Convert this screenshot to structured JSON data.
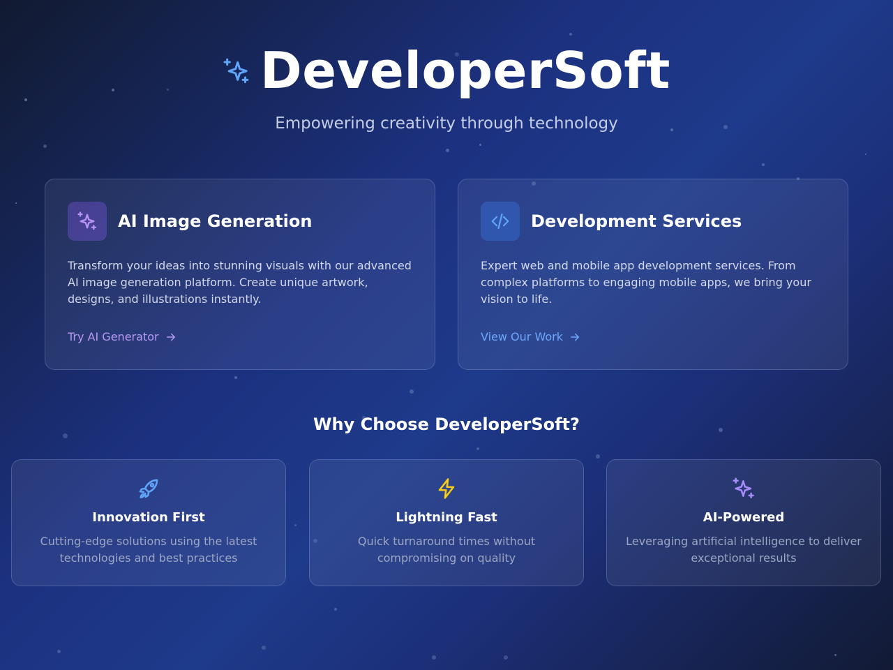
{
  "header": {
    "brand_icon": "sparkles-icon",
    "title": "DeveloperSoft",
    "tagline": "Empowering creativity through technology"
  },
  "services": [
    {
      "icon": "sparkles-icon",
      "title": "AI Image Generation",
      "description": "Transform your ideas into stunning visuals with our advanced AI image generation platform. Create unique artwork, designs, and illustrations instantly.",
      "link_label": "Try AI Generator",
      "accent": "#b89af4"
    },
    {
      "icon": "code-icon",
      "title": "Development Services",
      "description": "Expert web and mobile app development services. From complex platforms to engaging mobile apps, we bring your vision to life.",
      "link_label": "View Our Work",
      "accent": "#6ea8fb"
    }
  ],
  "why": {
    "title": "Why Choose DeveloperSoft?",
    "features": [
      {
        "icon": "rocket-icon",
        "title": "Innovation First",
        "description": "Cutting-edge solutions using the latest technologies and best practices",
        "color": "#60a5fa"
      },
      {
        "icon": "lightning-icon",
        "title": "Lightning Fast",
        "description": "Quick turnaround times without compromising on quality",
        "color": "#facc15"
      },
      {
        "icon": "sparkles-icon",
        "title": "AI-Powered",
        "description": "Leveraging artificial intelligence to deliver exceptional results",
        "color": "#a78bfa"
      }
    ]
  },
  "colors": {
    "background_start": "#111a30",
    "background_mid": "#1e3a8a",
    "text_muted": "#9ba7c4"
  }
}
